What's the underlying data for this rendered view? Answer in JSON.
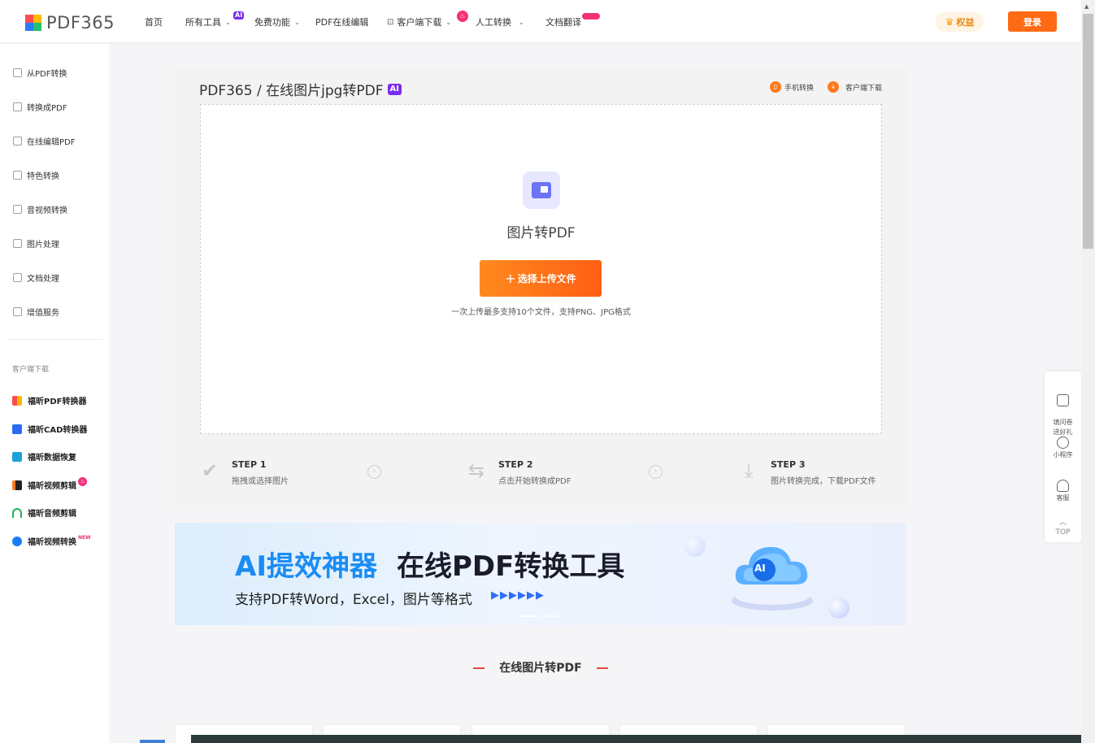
{
  "nav": {
    "logo_text": "PDF365",
    "items": [
      "首页",
      "所有工具",
      "免费功能",
      "PDF在线编辑",
      "客户端下载",
      "人工转换",
      "文档翻译"
    ],
    "ai_badge": "AI",
    "vip_label": "权益",
    "login_label": "登录"
  },
  "sidebar": {
    "items": [
      "从PDF转换",
      "转换成PDF",
      "在线编辑PDF",
      "特色转换",
      "音视频转换",
      "图片处理",
      "文档处理",
      "增值服务"
    ],
    "client_heading": "客户端下载",
    "apps": [
      "福昕PDF转换器",
      "福昕CAD转换器",
      "福昕数据恢复",
      "福昕视频剪辑",
      "福昕音频剪辑",
      "福昕视频转换"
    ],
    "new_badge": "NEW"
  },
  "main": {
    "breadcrumb": "PDF365 / 在线图片jpg转PDF",
    "ai_tag": "AI",
    "mobile_link": "手机转换",
    "client_link": "客户端下载",
    "tool_title": "图片转PDF",
    "upload_label": "选择上传文件",
    "upload_hint": "一次上传最多支持10个文件，支持PNG、JPG格式",
    "steps": [
      {
        "title": "STEP 1",
        "desc": "拖拽或选择图片"
      },
      {
        "title": "STEP 2",
        "desc": "点击开始转换成PDF"
      },
      {
        "title": "STEP 3",
        "desc": "图片转换完成，下载PDF文件"
      }
    ]
  },
  "banner": {
    "title_blue": "AI提效神器",
    "title_dark": "在线PDF转换工具",
    "subtitle": "支持PDF转Word，Excel，图片等格式",
    "cloud_label": "AI"
  },
  "section": {
    "title": "在线图片转PDF"
  },
  "float": {
    "survey": "填问卷\n送好礼",
    "mini": "小程序",
    "service": "客服",
    "top": "TOP"
  },
  "colors": {
    "accent": "#ff6a14",
    "ai_purple": "#7a2cf0",
    "banner_blue": "#1a8cf5"
  }
}
